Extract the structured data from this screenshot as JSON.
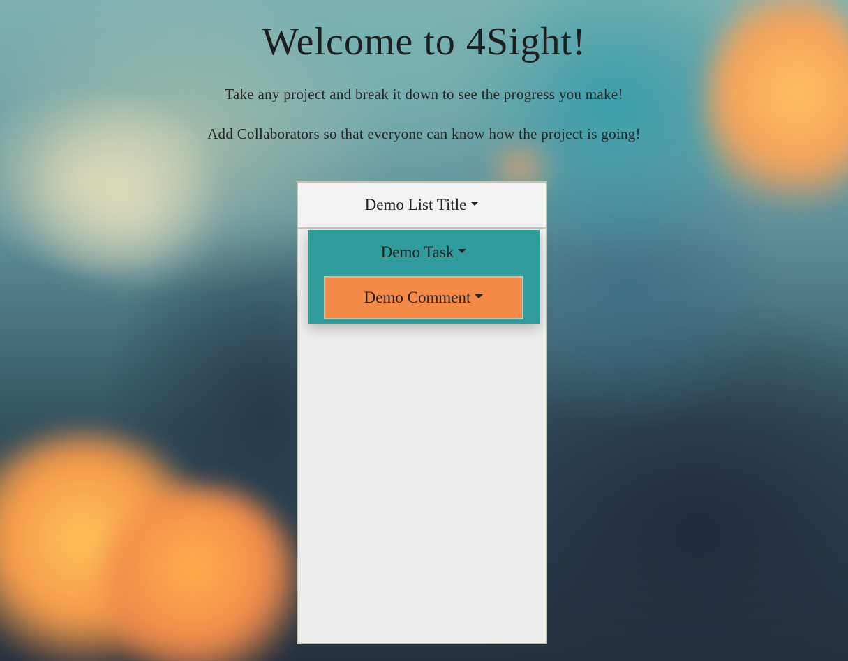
{
  "header": {
    "title": "Welcome to 4Sight!",
    "line1": "Take any project and break it down to see the progress you make!",
    "line2": "Add Collaborators so that everyone can know how the project is going!"
  },
  "list": {
    "title": "Demo List Title",
    "task": {
      "title": "Demo Task",
      "comment": "Demo Comment"
    }
  },
  "icons": {
    "dropdown": "caret-down-icon"
  },
  "colors": {
    "list_background": "#ededed",
    "list_header": "#f2f2f2",
    "task": "#2f9b9b",
    "comment": "#f48a48",
    "text": "#232323"
  }
}
